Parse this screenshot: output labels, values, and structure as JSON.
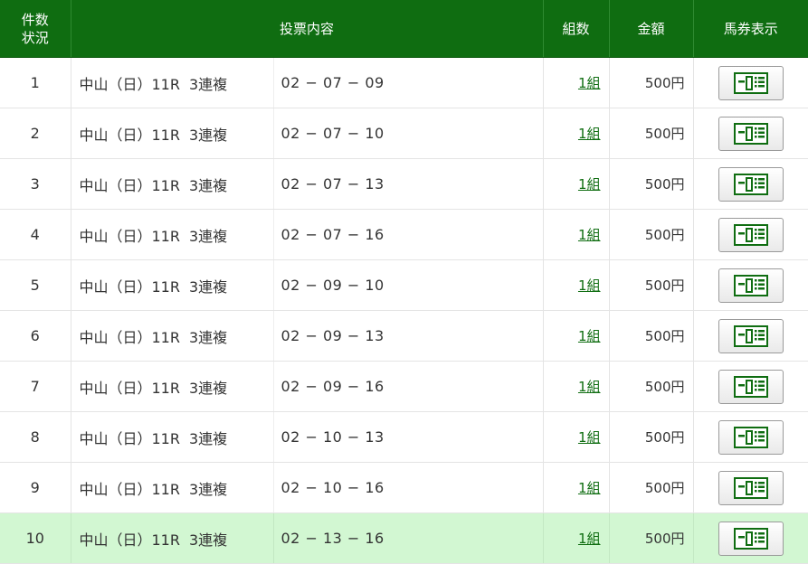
{
  "header": {
    "no_line1": "件数",
    "no_line2": "状況",
    "content": "投票内容",
    "kumi": "組数",
    "amount": "金額",
    "ticket": "馬券表示"
  },
  "colors": {
    "header_bg": "#0f6d11",
    "link": "#0f6d11",
    "highlight_row": "#d2f7d2"
  },
  "ticket_icon": "ticket-icon",
  "rows": [
    {
      "no": "1",
      "venue": "中山（日）11R",
      "type": "3連複",
      "combo": "02 − 07 − 09",
      "kumi": "1組",
      "amount": "500円"
    },
    {
      "no": "2",
      "venue": "中山（日）11R",
      "type": "3連複",
      "combo": "02 − 07 − 10",
      "kumi": "1組",
      "amount": "500円"
    },
    {
      "no": "3",
      "venue": "中山（日）11R",
      "type": "3連複",
      "combo": "02 − 07 − 13",
      "kumi": "1組",
      "amount": "500円"
    },
    {
      "no": "4",
      "venue": "中山（日）11R",
      "type": "3連複",
      "combo": "02 − 07 − 16",
      "kumi": "1組",
      "amount": "500円"
    },
    {
      "no": "5",
      "venue": "中山（日）11R",
      "type": "3連複",
      "combo": "02 − 09 − 10",
      "kumi": "1組",
      "amount": "500円"
    },
    {
      "no": "6",
      "venue": "中山（日）11R",
      "type": "3連複",
      "combo": "02 − 09 − 13",
      "kumi": "1組",
      "amount": "500円"
    },
    {
      "no": "7",
      "venue": "中山（日）11R",
      "type": "3連複",
      "combo": "02 − 09 − 16",
      "kumi": "1組",
      "amount": "500円"
    },
    {
      "no": "8",
      "venue": "中山（日）11R",
      "type": "3連複",
      "combo": "02 − 10 − 13",
      "kumi": "1組",
      "amount": "500円"
    },
    {
      "no": "9",
      "venue": "中山（日）11R",
      "type": "3連複",
      "combo": "02 − 10 − 16",
      "kumi": "1組",
      "amount": "500円"
    },
    {
      "no": "10",
      "venue": "中山（日）11R",
      "type": "3連複",
      "combo": "02 − 13 − 16",
      "kumi": "1組",
      "amount": "500円",
      "highlight": true
    }
  ]
}
